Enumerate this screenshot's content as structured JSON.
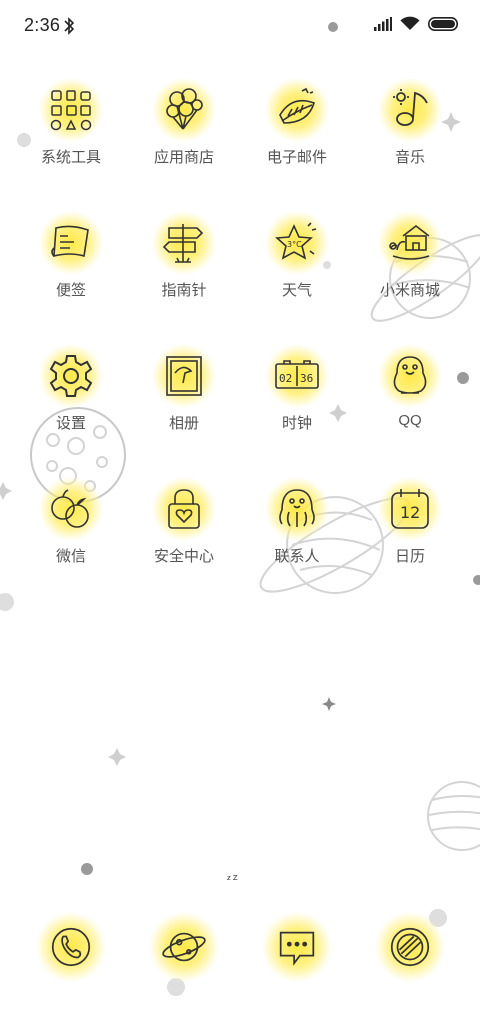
{
  "status": {
    "time": "2:36",
    "icons": [
      "bluetooth-icon",
      "signal-icon",
      "wifi-icon",
      "battery-icon"
    ]
  },
  "apps": [
    {
      "label": "系统工具",
      "icon": "tools-folder-icon"
    },
    {
      "label": "应用商店",
      "icon": "balloons-icon"
    },
    {
      "label": "电子邮件",
      "icon": "leaf-mail-icon"
    },
    {
      "label": "音乐",
      "icon": "music-note-icon"
    },
    {
      "label": "便签",
      "icon": "scroll-note-icon"
    },
    {
      "label": "指南针",
      "icon": "signpost-icon"
    },
    {
      "label": "天气",
      "icon": "weather-star-icon"
    },
    {
      "label": "小米商城",
      "icon": "turtle-house-icon"
    },
    {
      "label": "设置",
      "icon": "gear-icon"
    },
    {
      "label": "相册",
      "icon": "photo-frame-icon"
    },
    {
      "label": "时钟",
      "icon": "digital-clock-icon"
    },
    {
      "label": "QQ",
      "icon": "penguin-icon"
    },
    {
      "label": "微信",
      "icon": "apples-icon"
    },
    {
      "label": "安全中心",
      "icon": "padlock-heart-icon"
    },
    {
      "label": "联系人",
      "icon": "octopus-icon"
    },
    {
      "label": "日历",
      "icon": "calendar-icon"
    }
  ],
  "clock_icon_digits": [
    "02",
    "36"
  ],
  "calendar_icon_day": "12",
  "weather_icon_text": "3°C",
  "dock": [
    {
      "icon": "phone-icon"
    },
    {
      "icon": "planet-browser-icon"
    },
    {
      "icon": "chat-bubble-icon"
    },
    {
      "icon": "camera-lens-icon"
    }
  ],
  "page_indicator_text": "z Z",
  "colors": {
    "glow": "#ffe63c",
    "label": "#555555",
    "line": "#333333"
  }
}
